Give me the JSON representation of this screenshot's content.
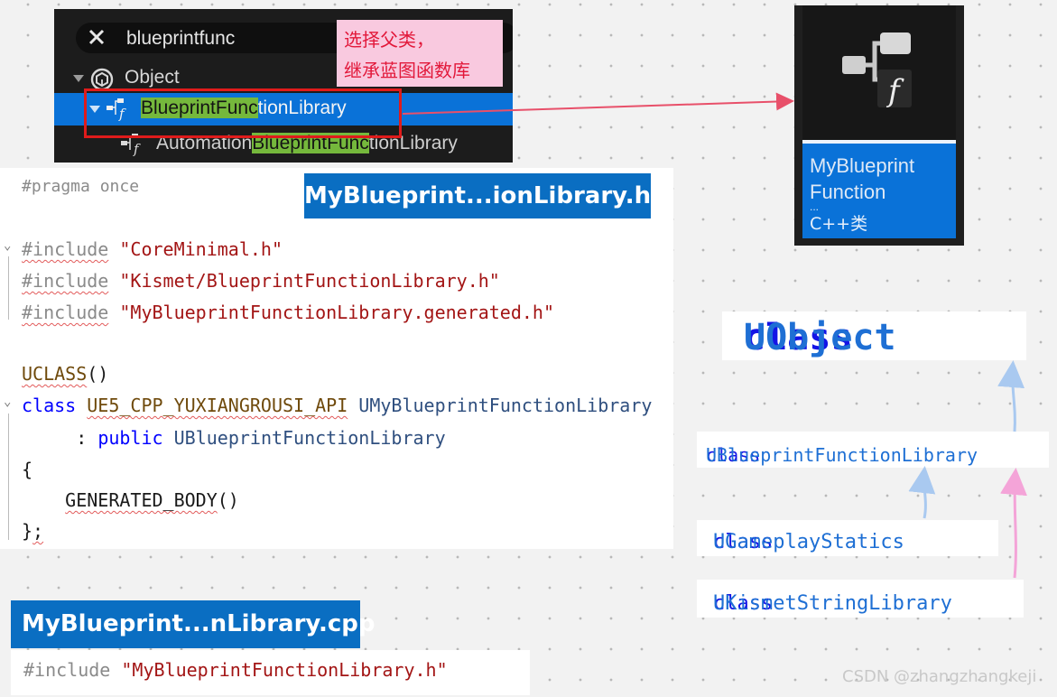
{
  "picker": {
    "search_value": "blueprintfunc",
    "tooltip_line1": "选择父类，",
    "tooltip_line2": "继承蓝图函数库",
    "rows": {
      "object": "Object",
      "bfl_match": "BlueprintFunc",
      "bfl_rest": "tionLibrary",
      "auto_pre": "Automation",
      "auto_match": "BlueprintFunc",
      "auto_rest": "tionLibrary"
    }
  },
  "asset": {
    "name_line1": "MyBlueprint",
    "name_line2": "Function",
    "ellipsis": "...",
    "type": "C++类"
  },
  "header_file": {
    "tab": "MyBlueprint...ionLibrary.h*",
    "pragma": "#pragma once",
    "directive": "#include",
    "inc1": "\"CoreMinimal.h\"",
    "inc2": "\"Kismet/BlueprintFunctionLibrary.h\"",
    "inc3": "\"MyBlueprintFunctionLibrary.generated.h\"",
    "uclass": "UCLASS",
    "uclass_parens": "()",
    "class_kw": "class",
    "api_macro": "UE5_CPP_YUXIANGROUSI_API",
    "class_name": "UMyBlueprintFunctionLibrary",
    "colon": ":",
    "public_kw": "public",
    "base_class": "UBlueprintFunctionLibrary",
    "open_brace": "{",
    "generated_body": "GENERATED_BODY",
    "gb_parens": "()",
    "close_brace": "}",
    "semicolon": ";"
  },
  "cpp_file": {
    "tab": "MyBlueprint...nLibrary.cpp",
    "directive": "#include",
    "inc": "\"MyBlueprintFunctionLibrary.h\""
  },
  "hierarchy": {
    "uobject": {
      "kw": "class",
      "name": "UObject"
    },
    "ubfl": {
      "kw": "class",
      "name": "UBlueprintFunctionLibrary"
    },
    "ugameplay": {
      "kw": "class",
      "name": "UGameplayStatics"
    },
    "ukismet": {
      "kw": "class",
      "name": "UKismetStringLibrary"
    }
  },
  "colors": {
    "selection_blue": "#0a72d8",
    "tab_blue": "#0a6ec2",
    "match_green": "#75b83c",
    "highlight_red": "#e01b1b",
    "arrow_blue": "#a9c9f0",
    "arrow_pink": "#f4a4d8"
  },
  "icons": [
    "close-icon",
    "object-class-icon",
    "function-library-icon",
    "blueprint-function-icon"
  ],
  "watermark": "CSDN @zhangzhangkeji"
}
